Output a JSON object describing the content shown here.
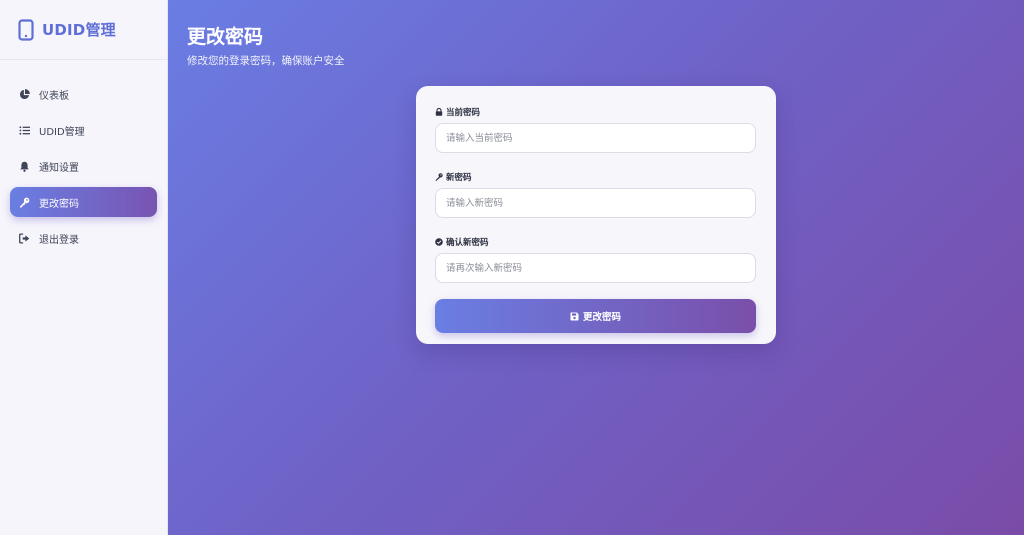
{
  "brand": {
    "title": "UDID管理",
    "icon": "mobile-phone-icon",
    "color": "#5f6fd6"
  },
  "sidebar": {
    "items": [
      {
        "label": "仪表板",
        "icon": "pie-chart-icon",
        "active": false
      },
      {
        "label": "UDID管理",
        "icon": "list-icon",
        "active": false
      },
      {
        "label": "通知设置",
        "icon": "bell-icon",
        "active": false
      },
      {
        "label": "更改密码",
        "icon": "key-icon",
        "active": true
      },
      {
        "label": "退出登录",
        "icon": "logout-icon",
        "active": false
      }
    ]
  },
  "page": {
    "title": "更改密码",
    "subtitle": "修改您的登录密码，确保账户安全"
  },
  "form": {
    "current": {
      "label": "当前密码",
      "icon": "lock-icon",
      "placeholder": "请输入当前密码",
      "value": ""
    },
    "new": {
      "label": "新密码",
      "icon": "key-icon",
      "placeholder": "请输入新密码",
      "value": ""
    },
    "confirm": {
      "label": "确认新密码",
      "icon": "check-circle-icon",
      "placeholder": "请再次输入新密码",
      "value": ""
    },
    "submit_label": "更改密码",
    "submit_icon": "save-icon"
  },
  "colors": {
    "accent_start": "#6a7ee3",
    "accent_end": "#7a4fa9"
  }
}
